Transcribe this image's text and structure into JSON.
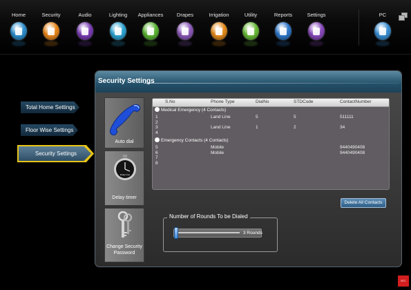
{
  "nav": {
    "items": [
      {
        "label": "Home",
        "color": "#2f8fcd",
        "icon": "home-icon"
      },
      {
        "label": "Security",
        "color": "#e9881d",
        "icon": "shield-icon"
      },
      {
        "label": "Audio",
        "color": "#7b3fb5",
        "icon": "music-note-icon"
      },
      {
        "label": "Lighting",
        "color": "#2fa4d4",
        "icon": "bulb-icon"
      },
      {
        "label": "Appliances",
        "color": "#5bb534",
        "icon": "appliance-icon"
      },
      {
        "label": "Drapes",
        "color": "#8c5ab8",
        "icon": "drapes-icon"
      },
      {
        "label": "Irrigation",
        "color": "#e58c1d",
        "icon": "watering-can-icon"
      },
      {
        "label": "Utility",
        "color": "#6cbc3a",
        "icon": "utility-icon"
      },
      {
        "label": "Reports",
        "color": "#2f78c9",
        "icon": "report-icon"
      },
      {
        "label": "Settings",
        "color": "#8a4bbd",
        "icon": "gear-icon"
      },
      {
        "label": "PC",
        "color": "#3b8fd3",
        "icon": "monitor-icon"
      }
    ]
  },
  "left_nav": {
    "total_home": "Total Home Settings",
    "floor_wise": "Floor Wise Settings",
    "security": "Security Settings"
  },
  "panel": {
    "title": "Security Settings",
    "side": {
      "autodial": "Auto dial",
      "delay": "Delay timer",
      "delay_face": "Delay time",
      "password": "Change Security Password"
    }
  },
  "table": {
    "headers": [
      "S.No",
      "Phone Type",
      "DialNo",
      "STDCode",
      "ContactNumber"
    ],
    "groups": [
      {
        "title": "Medical Emergency (4 Contacts)",
        "rows": [
          [
            "1",
            "Land Line",
            "5",
            "5",
            "511111"
          ],
          [
            "2",
            "",
            "",
            "",
            ""
          ],
          [
            "3",
            "Land Line",
            "1",
            "2",
            "34"
          ],
          [
            "4",
            "",
            "",
            "",
            ""
          ]
        ]
      },
      {
        "title": "Emergency Contacts (4 Contacts)",
        "rows": [
          [
            "5",
            "Mobile",
            "",
            "",
            "9440490408"
          ],
          [
            "6",
            "Mobile",
            "",
            "",
            "9440490408"
          ],
          [
            "7",
            "",
            "",
            "",
            ""
          ],
          [
            "8",
            "",
            "",
            "",
            ""
          ]
        ]
      }
    ]
  },
  "buttons": {
    "delete_all": "Delete All Contacts"
  },
  "rounds": {
    "title": "Number of Rounds To be Dialed",
    "value_label": "3 Rounds",
    "level_fraction": 0.0
  },
  "brand": {
    "label": "BTC"
  }
}
